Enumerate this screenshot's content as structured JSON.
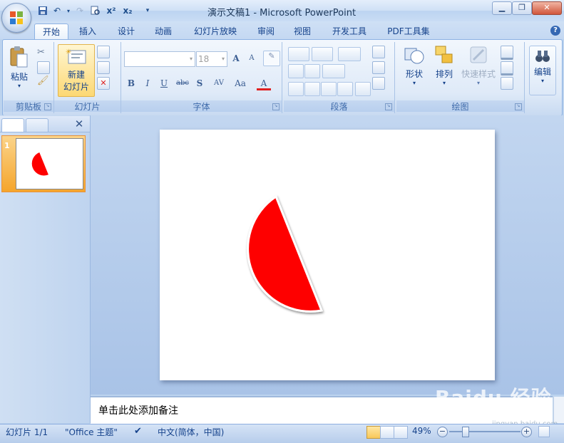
{
  "window": {
    "title": "演示文稿1 - Microsoft PowerPoint",
    "minimize": "▁",
    "maximize": "❐",
    "close": "✕"
  },
  "quick_access": [
    "save-icon",
    "undo-icon",
    "redo-icon",
    "print-preview-icon",
    "superscript-icon",
    "subscript-icon",
    "customize-icon"
  ],
  "quick_access_labels": {
    "superscript": "x²",
    "subscript": "x₂"
  },
  "tabs": [
    {
      "label": "开始",
      "active": true
    },
    {
      "label": "插入"
    },
    {
      "label": "设计"
    },
    {
      "label": "动画"
    },
    {
      "label": "幻灯片放映"
    },
    {
      "label": "审阅"
    },
    {
      "label": "视图"
    },
    {
      "label": "开发工具"
    },
    {
      "label": "PDF工具集"
    }
  ],
  "ribbon": {
    "clipboard": {
      "label": "剪贴板",
      "paste": "粘贴"
    },
    "slides": {
      "label": "幻灯片",
      "new_slide_line1": "新建",
      "new_slide_line2": "幻灯片"
    },
    "font": {
      "label": "字体",
      "font_name": "",
      "font_size": "18",
      "grow": "A",
      "shrink": "A",
      "bold": "B",
      "italic": "I",
      "underline": "U",
      "strike": "abc",
      "shadow": "S",
      "spacing": "AV",
      "case": "Aa",
      "color": "A"
    },
    "paragraph": {
      "label": "段落"
    },
    "drawing": {
      "label": "绘图",
      "shapes": "形状",
      "arrange": "排列",
      "quick_styles": "快速样式"
    },
    "editing": {
      "label": "编辑"
    }
  },
  "slides_panel": {
    "slide_number": "1"
  },
  "notes": {
    "placeholder": "单击此处添加备注"
  },
  "status": {
    "slide_info": "幻灯片 1/1",
    "theme": "\"Office 主题\"",
    "language": "中文(简体，中国)",
    "zoom": "49%"
  },
  "watermark": {
    "text": "Baidu 经验",
    "sub": "jingyan.baidu.com"
  },
  "colors": {
    "shape_fill": "#fe0000",
    "accent": "#15428b"
  }
}
